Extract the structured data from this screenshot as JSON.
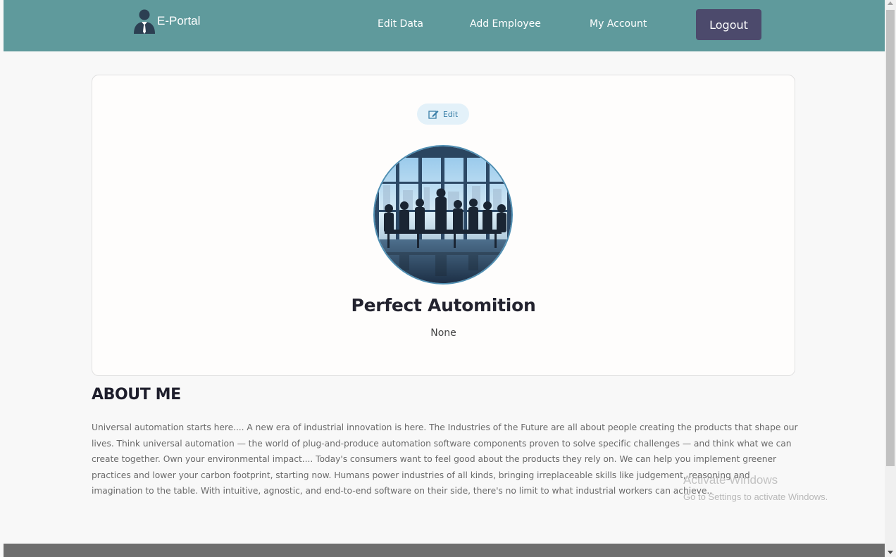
{
  "brand": {
    "name": "E-Portal",
    "logo_icon": "businessman-icon"
  },
  "nav": {
    "links": [
      {
        "label": "Edit Data"
      },
      {
        "label": "Add Employee"
      },
      {
        "label": "My Account"
      }
    ],
    "logout_label": "Logout",
    "bar_color": "#5f9a9c",
    "logout_color": "#4c4a6c"
  },
  "profile": {
    "edit_label": "Edit",
    "edit_icon": "edit-square-icon",
    "name": "Perfect Automition",
    "role": "None",
    "avatar_icon": "meeting-silhouette-photo"
  },
  "about": {
    "heading": "ABOUT ME",
    "text": "Universal automation starts here.... A new era of industrial innovation is here. The Industries of the Future are all about people creating the products that shape our lives. Think universal automation — the world of plug-and-produce automation software components proven to solve specific challenges — and think what we can create together. Own your environmental impact.... Today's consumers want to feel good about the products they rely on. We can help you implement greener practices and lower your carbon footprint, starting now. Humans power industries of all kinds, bringing irreplaceable skills like judgement, reasoning and imagination to the table. With intuitive, agnostic, and end-to-end software on their side, there's no limit to what industrial workers can achieve.."
  },
  "os_watermark": {
    "title": "Activate Windows",
    "subtitle": "Go to Settings to activate Windows."
  }
}
